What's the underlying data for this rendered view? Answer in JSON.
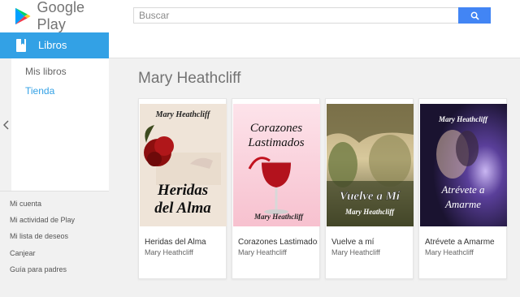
{
  "header": {
    "logo_text": "Google Play",
    "search_placeholder": "Buscar",
    "search_icon": "search-icon"
  },
  "category": {
    "label": "Libros",
    "icon": "book-icon"
  },
  "sidebar": {
    "links": [
      {
        "label": "Mis libros"
      },
      {
        "label": "Tienda",
        "active": true
      }
    ],
    "bottom_items": [
      {
        "label": "Mi cuenta"
      },
      {
        "label": "Mi actividad de Play"
      },
      {
        "label": "Mi lista de deseos"
      },
      {
        "label": "Canjear"
      },
      {
        "label": "Guía para padres"
      }
    ]
  },
  "main": {
    "title": "Mary Heathcliff",
    "books": [
      {
        "title": "Heridas del Alma",
        "author": "Mary Heathcliff",
        "cover_title_lines": [
          "Heridas",
          "del Alma"
        ],
        "cover_author": "Mary Heathcliff"
      },
      {
        "title": "Corazones Lastimados",
        "author": "Mary Heathcliff",
        "cover_title_lines": [
          "Corazones",
          "Lastimados"
        ],
        "cover_author": "Mary Heathcliff"
      },
      {
        "title": "Vuelve a mí",
        "author": "Mary Heathcliff",
        "cover_title_lines": [
          "Vuelve a Mí"
        ],
        "cover_author": "Mary Heathcliff"
      },
      {
        "title": "Atrévete a Amarme",
        "author": "Mary Heathcliff",
        "cover_title_lines": [
          "Atrévete a",
          "Amarme"
        ],
        "cover_author": "Mary Heathcliff"
      }
    ]
  },
  "colors": {
    "accent": "#33a1e5",
    "search_button": "#4285f4",
    "background": "#f1f1f1"
  }
}
